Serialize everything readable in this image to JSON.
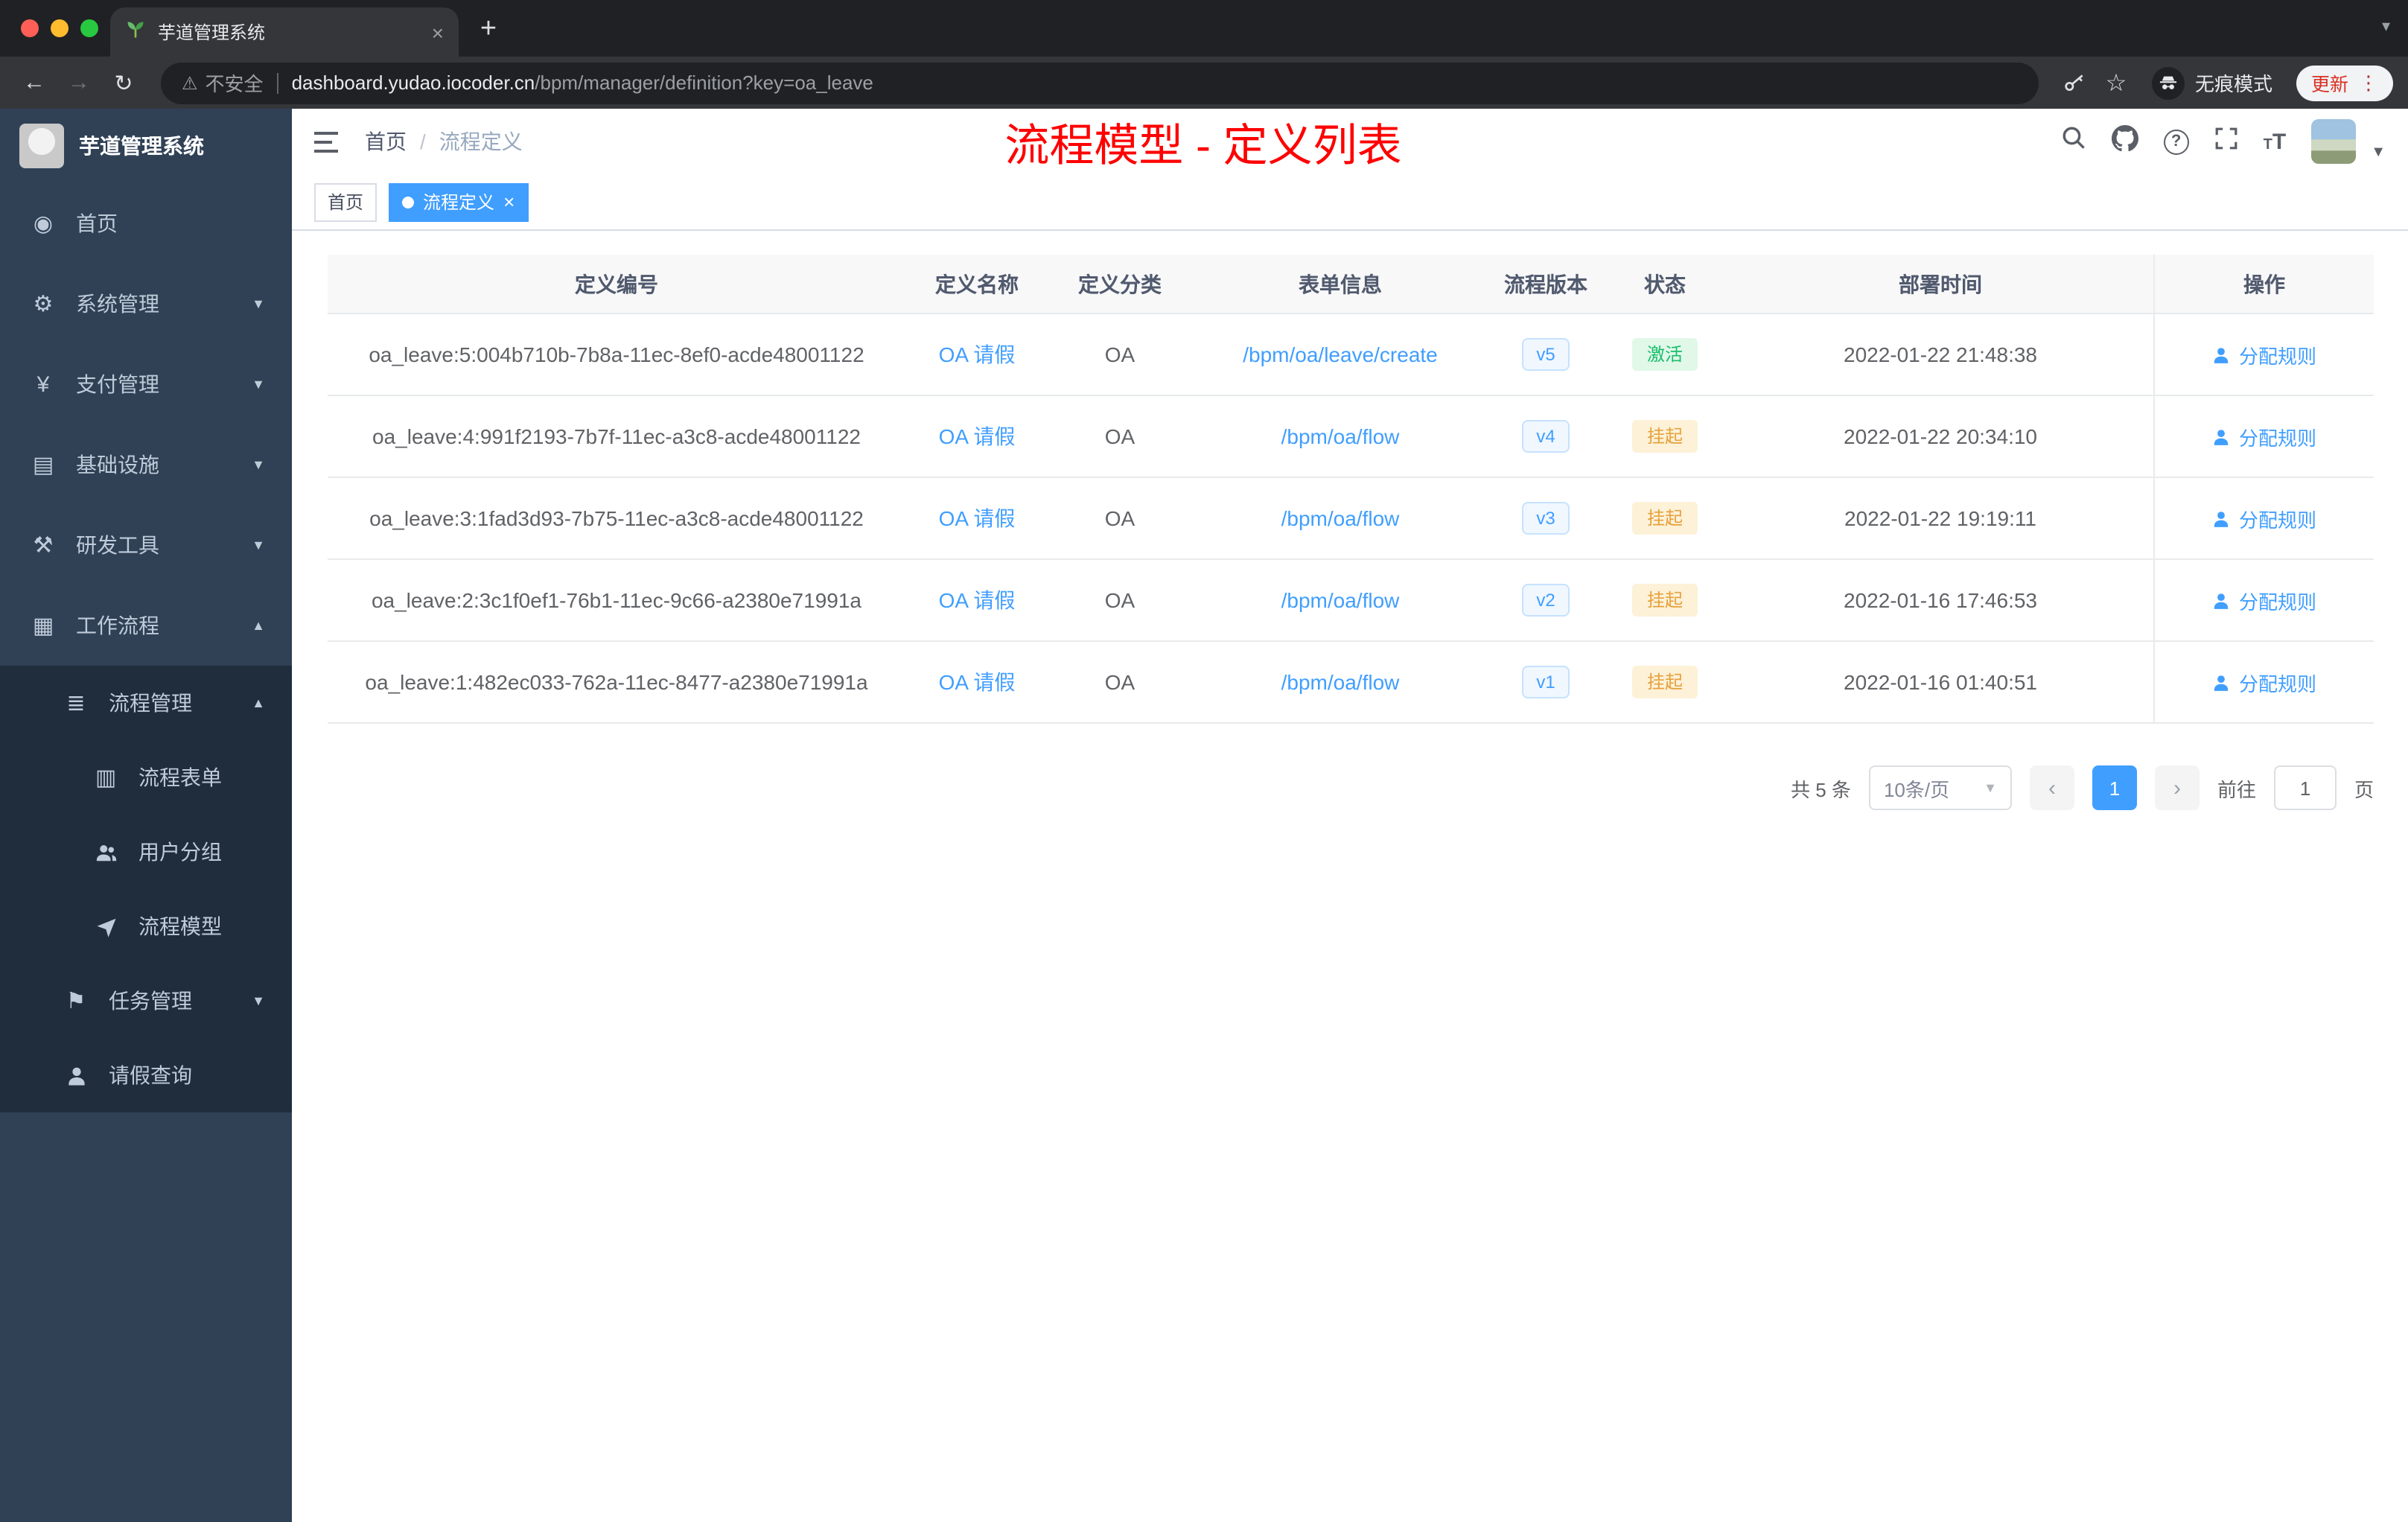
{
  "browser": {
    "tab_title": "芋道管理系统",
    "security_label": "不安全",
    "url_host": "dashboard.yudao.iocoder.cn",
    "url_path": "/bpm/manager/definition?key=oa_leave",
    "incognito_label": "无痕模式",
    "update_label": "更新"
  },
  "sidebar": {
    "app_title": "芋道管理系统",
    "items": [
      {
        "label": "首页"
      },
      {
        "label": "系统管理"
      },
      {
        "label": "支付管理"
      },
      {
        "label": "基础设施"
      },
      {
        "label": "研发工具"
      },
      {
        "label": "工作流程"
      },
      {
        "label": "流程管理"
      },
      {
        "label": "流程表单"
      },
      {
        "label": "用户分组"
      },
      {
        "label": "流程模型"
      },
      {
        "label": "任务管理"
      },
      {
        "label": "请假查询"
      }
    ]
  },
  "header": {
    "breadcrumb": [
      "首页",
      "流程定义"
    ],
    "annotation": "流程模型 - 定义列表"
  },
  "tags": [
    {
      "label": "首页"
    },
    {
      "label": "流程定义"
    }
  ],
  "table": {
    "columns": [
      "定义编号",
      "定义名称",
      "定义分类",
      "表单信息",
      "流程版本",
      "状态",
      "部署时间",
      "操作"
    ],
    "rows": [
      {
        "id": "oa_leave:5:004b710b-7b8a-11ec-8ef0-acde48001122",
        "name": "OA 请假",
        "category": "OA",
        "form": "/bpm/oa/leave/create",
        "version": "v5",
        "status": "激活",
        "status_type": "success",
        "time": "2022-01-22 21:48:38",
        "action": "分配规则"
      },
      {
        "id": "oa_leave:4:991f2193-7b7f-11ec-a3c8-acde48001122",
        "name": "OA 请假",
        "category": "OA",
        "form": "/bpm/oa/flow",
        "version": "v4",
        "status": "挂起",
        "status_type": "warning",
        "time": "2022-01-22 20:34:10",
        "action": "分配规则"
      },
      {
        "id": "oa_leave:3:1fad3d93-7b75-11ec-a3c8-acde48001122",
        "name": "OA 请假",
        "category": "OA",
        "form": "/bpm/oa/flow",
        "version": "v3",
        "status": "挂起",
        "status_type": "warning",
        "time": "2022-01-22 19:19:11",
        "action": "分配规则"
      },
      {
        "id": "oa_leave:2:3c1f0ef1-76b1-11ec-9c66-a2380e71991a",
        "name": "OA 请假",
        "category": "OA",
        "form": "/bpm/oa/flow",
        "version": "v2",
        "status": "挂起",
        "status_type": "warning",
        "time": "2022-01-16 17:46:53",
        "action": "分配规则"
      },
      {
        "id": "oa_leave:1:482ec033-762a-11ec-8477-a2380e71991a",
        "name": "OA 请假",
        "category": "OA",
        "form": "/bpm/oa/flow",
        "version": "v1",
        "status": "挂起",
        "status_type": "warning",
        "time": "2022-01-16 01:40:51",
        "action": "分配规则"
      }
    ]
  },
  "pagination": {
    "total": "共 5 条",
    "page_size": "10条/页",
    "current_page": "1",
    "goto_label": "前往",
    "goto_value": "1",
    "page_unit": "页"
  },
  "colors": {
    "accent": "#409eff",
    "success": "#19be6b",
    "warning": "#e6a23c",
    "annotation_red": "#ff0000",
    "sidebar_bg": "#304156"
  }
}
